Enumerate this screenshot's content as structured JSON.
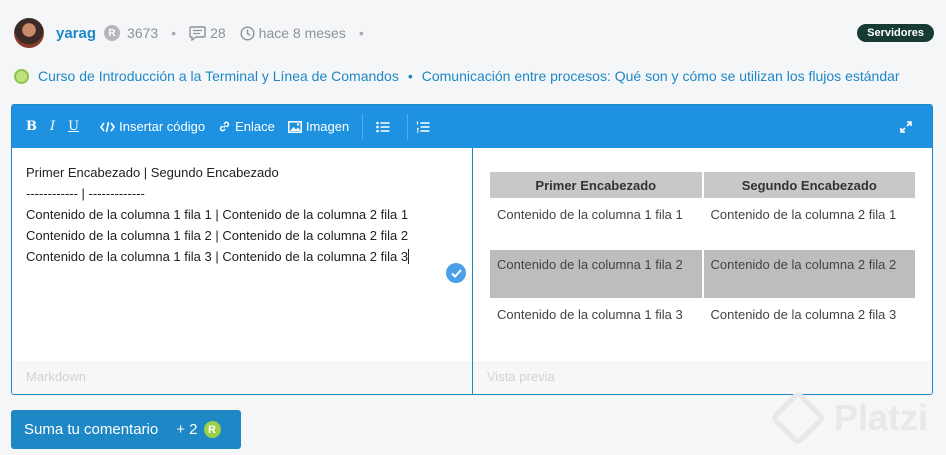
{
  "author": {
    "name": "yarag",
    "rank_letter": "R",
    "points": "3673"
  },
  "meta": {
    "comments": "28",
    "time": "hace 8 meses"
  },
  "tag": "Servidores",
  "breadcrumbs": [
    "Curso de Introducción a la Terminal y Línea de Comandos",
    "Comunicación entre procesos: Qué son y cómo se utilizan los flujos estándar"
  ],
  "toolbar": {
    "bold": "B",
    "italic": "I",
    "underline": "U",
    "code": "Insertar código",
    "link": "Enlace",
    "image": "Imagen"
  },
  "markdown": {
    "lines": [
      "Primer Encabezado | Segundo Encabezado",
      "------------ | -------------",
      "Contenido de la columna 1 fila 1 | Contenido de la columna 2 fila 1",
      "Contenido de la columna 1 fila 2 | Contenido de la columna 2 fila 2",
      "Contenido de la columna 1 fila 3 | Contenido de la columna 2 fila 3"
    ],
    "footer": "Markdown"
  },
  "preview": {
    "headers": [
      "Primer Encabezado",
      "Segundo Encabezado"
    ],
    "rows": [
      [
        "Contenido de la columna 1 fila 1",
        "Contenido de la columna 2 fila 1"
      ],
      [
        "Contenido de la columna 1 fila 2",
        "Contenido de la columna 2 fila 2"
      ],
      [
        "Contenido de la columna 1 fila 3",
        "Contenido de la columna 2 fila 3"
      ]
    ],
    "footer": "Vista previa"
  },
  "submit": {
    "label": "Suma tu comentario",
    "bonus": "+ 2",
    "badge": "R"
  },
  "watermark": "Platzi",
  "colors": {
    "accent": "#1e88c7",
    "toolbar": "#1e92e0",
    "tag_bg": "#173a35"
  }
}
